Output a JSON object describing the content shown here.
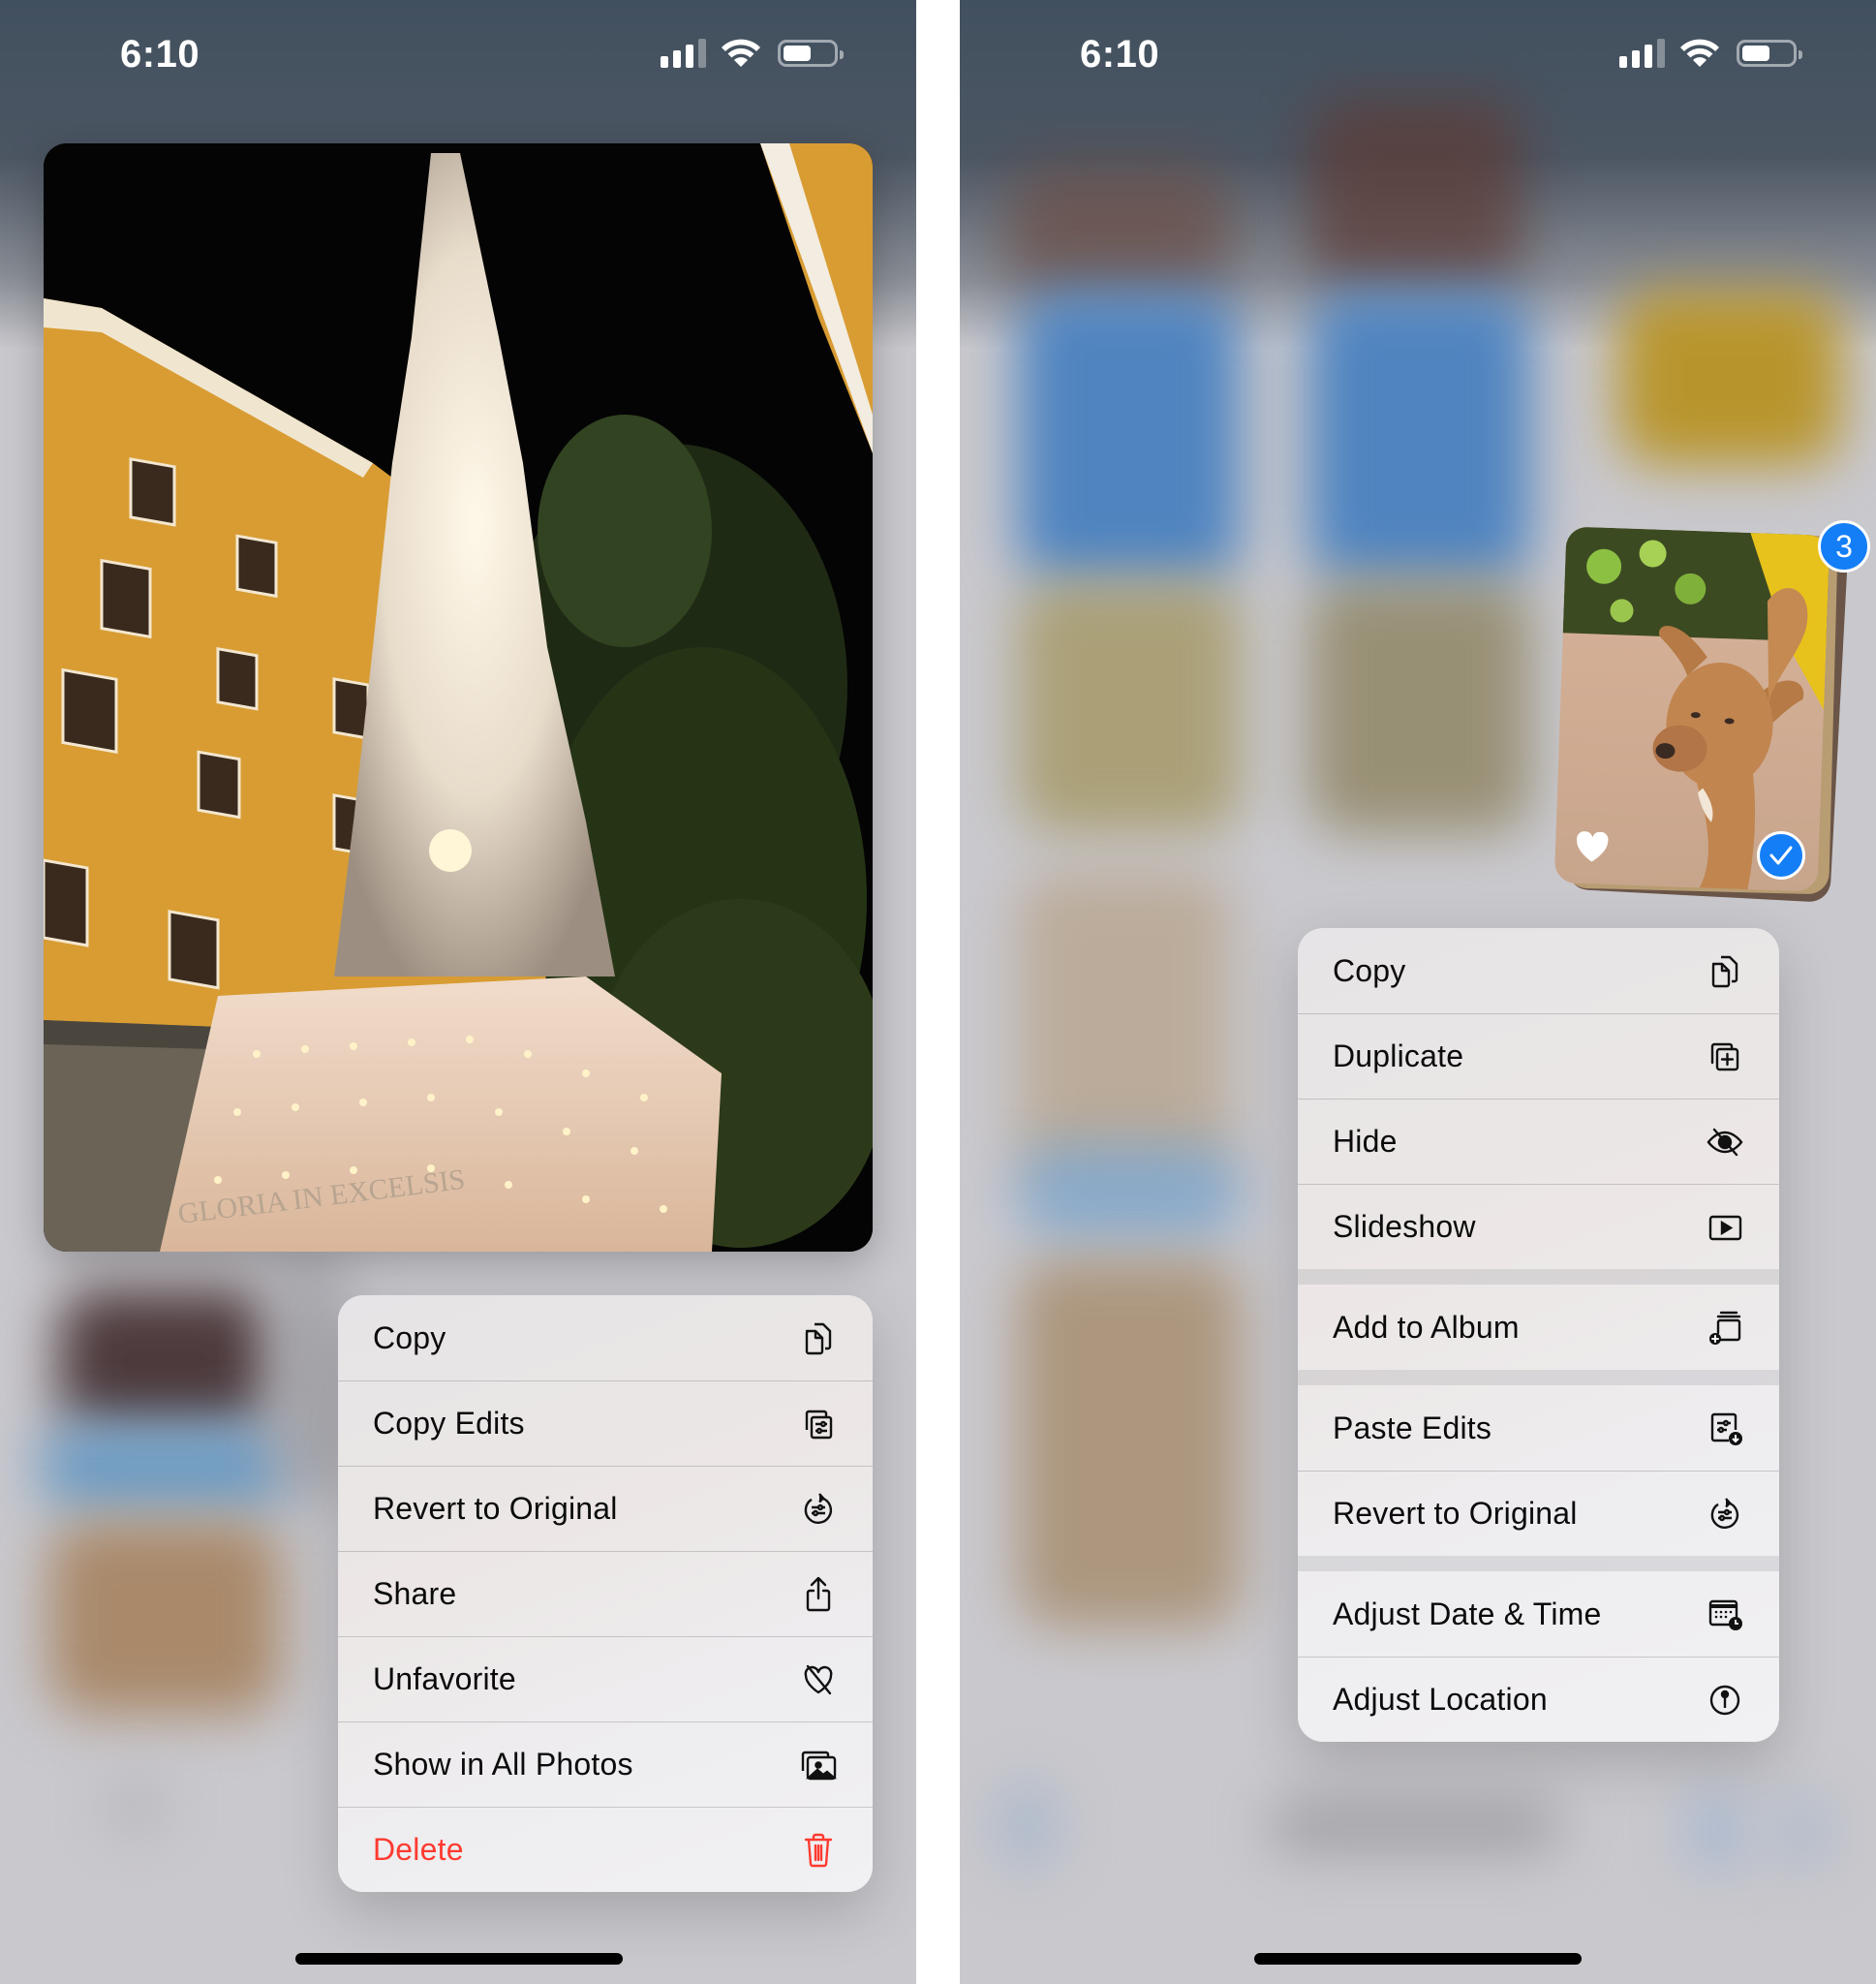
{
  "left_screen": {
    "status_bar": {
      "time": "6:10",
      "signal_bars": 3,
      "signal_bars_total": 4,
      "battery_level": 0.5
    },
    "preview_photo": {
      "subject": "illuminated white ornate tower monument at night with yellow building and tree",
      "inscription": "GLORIA IN EXCELSIS"
    },
    "context_menu": {
      "items": [
        {
          "label": "Copy",
          "icon": "copy-icon"
        },
        {
          "label": "Copy Edits",
          "icon": "copy-edits-icon"
        },
        {
          "label": "Revert to Original",
          "icon": "revert-icon"
        },
        {
          "label": "Share",
          "icon": "share-icon"
        },
        {
          "label": "Unfavorite",
          "icon": "heart-slash-icon"
        },
        {
          "label": "Show in All Photos",
          "icon": "photos-icon"
        },
        {
          "label": "Delete",
          "icon": "trash-icon",
          "destructive": true
        }
      ]
    }
  },
  "right_screen": {
    "status_bar": {
      "time": "6:10",
      "signal_bars": 3,
      "signal_bars_total": 4,
      "battery_level": 0.5
    },
    "selection": {
      "count_badge": "3",
      "favorited": true,
      "selected": true
    },
    "context_menu": {
      "sections": [
        [
          {
            "label": "Copy",
            "icon": "copy-icon"
          },
          {
            "label": "Duplicate",
            "icon": "duplicate-icon"
          },
          {
            "label": "Hide",
            "icon": "eye-slash-icon"
          },
          {
            "label": "Slideshow",
            "icon": "slideshow-icon"
          }
        ],
        [
          {
            "label": "Add to Album",
            "icon": "add-to-album-icon"
          }
        ],
        [
          {
            "label": "Paste Edits",
            "icon": "paste-edits-icon"
          },
          {
            "label": "Revert to Original",
            "icon": "revert-icon"
          }
        ],
        [
          {
            "label": "Adjust Date & Time",
            "icon": "calendar-clock-icon"
          },
          {
            "label": "Adjust Location",
            "icon": "location-pin-icon"
          }
        ]
      ]
    }
  },
  "colors": {
    "accent_blue": "#147ef6",
    "destructive_red": "#ff3b30",
    "backdrop_gray": "#c9c8cd",
    "building_yellow": "#e2a93a"
  }
}
